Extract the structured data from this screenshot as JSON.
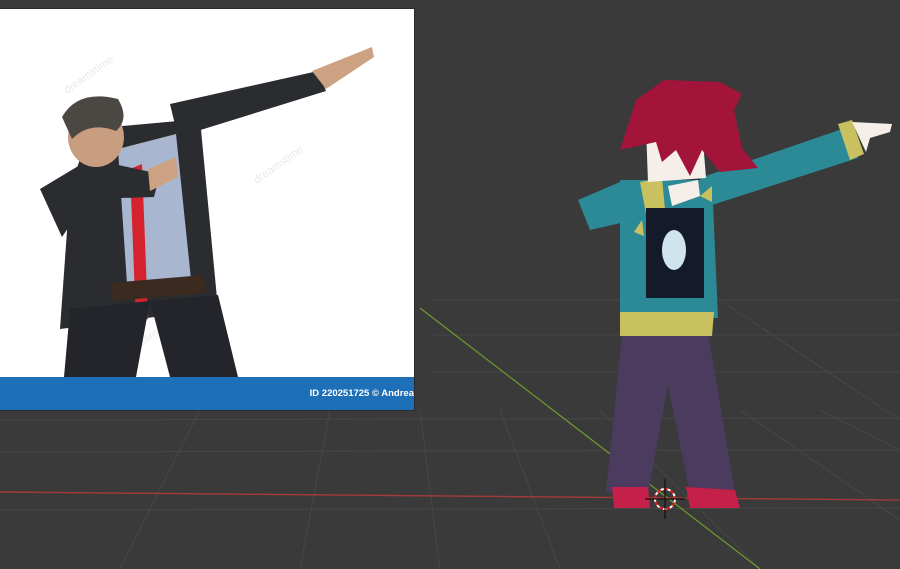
{
  "reference_image": {
    "credit": "ID 220251725 © Andrea",
    "watermark": "dreamstime",
    "colors": {
      "credit_bar": "#1d6fb8",
      "background": "#ffffff"
    }
  },
  "viewport": {
    "colors": {
      "background": "#3a3a3a",
      "grid": "#4a4a4a",
      "x_axis": "#a33a3a",
      "y_axis": "#6f9a2e"
    },
    "cursor_icon": "3d-cursor-icon"
  },
  "character": {
    "colors": {
      "hair": "#a2143a",
      "sweater": "#2b8a96",
      "trim": "#c9c060",
      "pants": "#4a3b5f",
      "shoes": "#c4204a",
      "skin": "#f6efe9"
    }
  }
}
